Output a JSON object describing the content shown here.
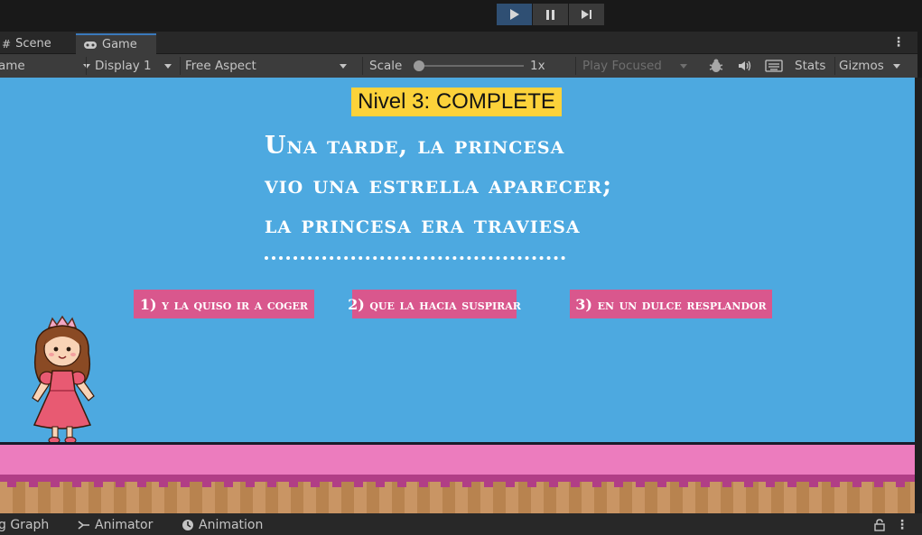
{
  "toolbar": {
    "play_icon": "play-icon",
    "pause_icon": "pause-icon",
    "step_icon": "step-icon"
  },
  "tabs": [
    {
      "label": "Scene",
      "icon": "hash-icon"
    },
    {
      "label": "Game",
      "icon": "gamepad-icon"
    }
  ],
  "game_toolbar": {
    "mode_value": "ame",
    "display": "Display 1",
    "aspect": "Free Aspect",
    "scale_label": "Scale",
    "scale_value": "1x",
    "scale_level": 0.0,
    "play_mode": "Play Focused",
    "stats": "Stats",
    "gizmos": "Gizmos"
  },
  "game": {
    "level_text": "Nivel 3: COMPLETE",
    "poem_lines": [
      "Una tarde, la princesa",
      "vio una estrella aparecer;",
      "la princesa era traviesa"
    ],
    "options": [
      "1) y la quiso ir a coger",
      "2) que la hacia suspirar",
      "3) en un dulce resplandor"
    ]
  },
  "bottom_tabs": [
    {
      "label": "g Graph",
      "icon": "graph-icon"
    },
    {
      "label": "Animator",
      "icon": "animator-icon"
    },
    {
      "label": "Animation",
      "icon": "animation-clock-icon"
    }
  ],
  "colors": {
    "sky": "#4da9e0",
    "level_badge": "#fcd23a",
    "option_bg": "#d9578d",
    "frosting": "#ec7cbe",
    "accent_play": "#2f4f73"
  }
}
